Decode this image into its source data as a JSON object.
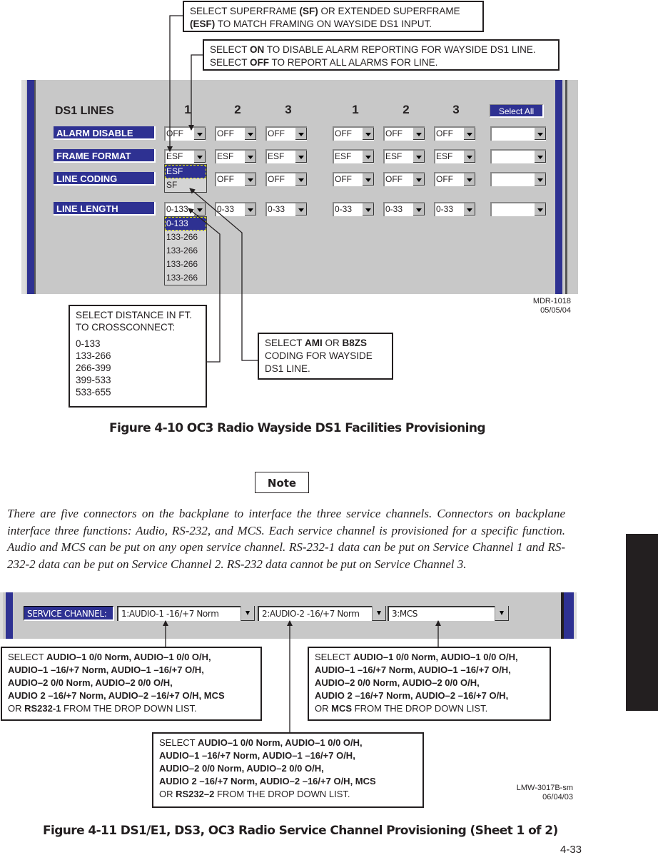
{
  "figure_4_10": {
    "callouts": {
      "frame_format": {
        "line1_pre": "SELECT SUPERFRAME ",
        "line1_b": "(SF)",
        "line1_post": " OR EXTENDED SUPERFRAME",
        "line2_b": "(ESF)",
        "line2_post": " TO MATCH FRAMING ON WAYSIDE DS1 INPUT."
      },
      "alarm_disable": {
        "line1_pre": "SELECT ",
        "line1_b": "ON",
        "line1_post": " TO DISABLE ALARM REPORTING FOR WAYSIDE DS1 LINE.",
        "line2_pre": "SELECT ",
        "line2_b": "OFF",
        "line2_post": " TO REPORT ALL ALARMS FOR LINE."
      },
      "distance": {
        "line1": "SELECT DISTANCE IN FT.",
        "line2": "TO CROSSCONNECT:",
        "options": [
          "0-133",
          "133-266",
          "266-399",
          "399-533",
          "533-655"
        ]
      },
      "coding": {
        "line1_pre": "SELECT ",
        "line1_b1": "AMI",
        "line1_mid": " OR ",
        "line1_b2": "B8ZS",
        "line2": "CODING FOR WAYSIDE",
        "line3": "DS1 LINE."
      }
    },
    "panel": {
      "title": "DS1 LINES",
      "column_numbers": [
        "1",
        "2",
        "3",
        "1",
        "2",
        "3"
      ],
      "select_all_label": "Select All",
      "rows": [
        {
          "label": "ALARM DISABLE",
          "values": [
            "OFF",
            "OFF",
            "OFF",
            "OFF",
            "OFF",
            "OFF"
          ],
          "all": ""
        },
        {
          "label": "FRAME FORMAT",
          "values": [
            "ESF",
            "ESF",
            "ESF",
            "ESF",
            "ESF",
            "ESF"
          ],
          "all": ""
        },
        {
          "label": "LINE CODING",
          "values": [
            "",
            "OFF",
            "OFF",
            "OFF",
            "OFF",
            "OFF"
          ],
          "all": ""
        },
        {
          "label": "LINE LENGTH",
          "values": [
            "0-133",
            "0-33",
            "0-33",
            "0-33",
            "0-33",
            "0-33"
          ],
          "all": ""
        }
      ],
      "frame_format_dropdown": [
        "ESF",
        "SF"
      ],
      "line_length_dropdown": [
        "0-133",
        "133-266",
        "133-266",
        "133-266",
        "133-266"
      ]
    },
    "doc_id": "MDR-1018",
    "doc_date": "05/05/04",
    "caption": "Figure 4-10  OC3 Radio Wayside DS1 Facilities Provisioning"
  },
  "note": {
    "label": "Note",
    "text": "There are five connectors on the backplane to interface the three service channels. Connectors on backplane interface three functions: Audio, RS-232, and MCS. Each service channel is provisioned for a specific function. Audio and MCS can be put on any open service channel. RS-232-1 data can be put on Service Channel 1 and RS-232-2 data can be put on Service Channel 2. RS-232 data cannot be put on Service Channel 3."
  },
  "figure_4_11": {
    "panel": {
      "label": "SERVICE CHANNEL:",
      "channels": [
        "1:AUDIO-1 -16/+7 Norm",
        "2:AUDIO-2 -16/+7 Norm",
        "3:MCS"
      ]
    },
    "callouts": [
      {
        "pre": "SELECT ",
        "l1": "AUDIO–1 0/0 Norm, AUDIO–1 0/0 O/H,",
        "l2": "AUDIO–1 –16/+7 Norm, AUDIO–1 –16/+7 O/H,",
        "l3": "AUDIO–2 0/0 Norm, AUDIO–2 0/0 O/H,",
        "l4": "AUDIO 2 –16/+7 Norm, AUDIO–2 –16/+7 O/H, MCS",
        "l5_pre": "OR ",
        "l5_b": "RS232-1",
        "l5_post": " FROM THE DROP DOWN LIST."
      },
      {
        "pre": "SELECT ",
        "l1": "AUDIO–1 0/0 Norm, AUDIO–1 0/0 O/H,",
        "l2": "AUDIO–1 –16/+7 Norm, AUDIO–1 –16/+7 O/H,",
        "l3": "AUDIO–2 0/0 Norm, AUDIO–2 0/0 O/H,",
        "l4": "AUDIO 2 –16/+7 Norm, AUDIO–2 –16/+7 O/H, MCS",
        "l5_pre": "OR ",
        "l5_b": "RS232–2",
        "l5_post": " FROM THE DROP DOWN LIST."
      },
      {
        "pre": "SELECT ",
        "l1": "AUDIO–1 0/0 Norm, AUDIO–1 0/0 O/H,",
        "l2": "AUDIO–1 –16/+7 Norm, AUDIO–1 –16/+7 O/H,",
        "l3": "AUDIO–2 0/0 Norm, AUDIO–2 0/0 O/H,",
        "l4": "AUDIO 2 –16/+7 Norm, AUDIO–2 –16/+7 O/H,",
        "l5_pre": "OR ",
        "l5_b": "MCS",
        "l5_post": " FROM THE DROP DOWN LIST."
      }
    ],
    "doc_id": "LMW-3017B-sm",
    "doc_date": "06/04/03",
    "caption": "Figure 4-11  DS1/E1, DS3, OC3 Radio Service Channel Provisioning (Sheet 1 of 2)"
  },
  "page_number": "4-33",
  "colors": {
    "panel_blue": "#2e3192",
    "panel_gray": "#c8c8c8",
    "ink": "#231f20"
  }
}
